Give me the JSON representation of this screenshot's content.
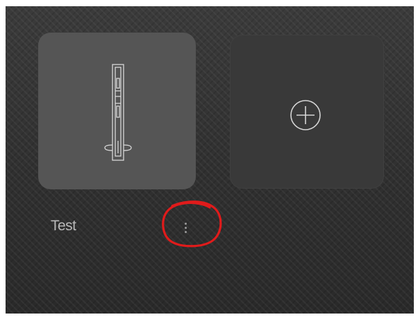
{
  "tiles": [
    {
      "name": "Test",
      "icon": "device-panel-icon",
      "menu_icon": "vertical-dots-icon"
    },
    {
      "name": "",
      "icon": "add-circle-icon"
    }
  ],
  "annotation": {
    "shape": "hand-drawn-circle",
    "color": "#e01b1b",
    "target": "tile-menu-button"
  },
  "colors": {
    "background": "#353535",
    "tile_active": "#555555",
    "tile_add": "#393939",
    "label": "#b9b9b9"
  }
}
